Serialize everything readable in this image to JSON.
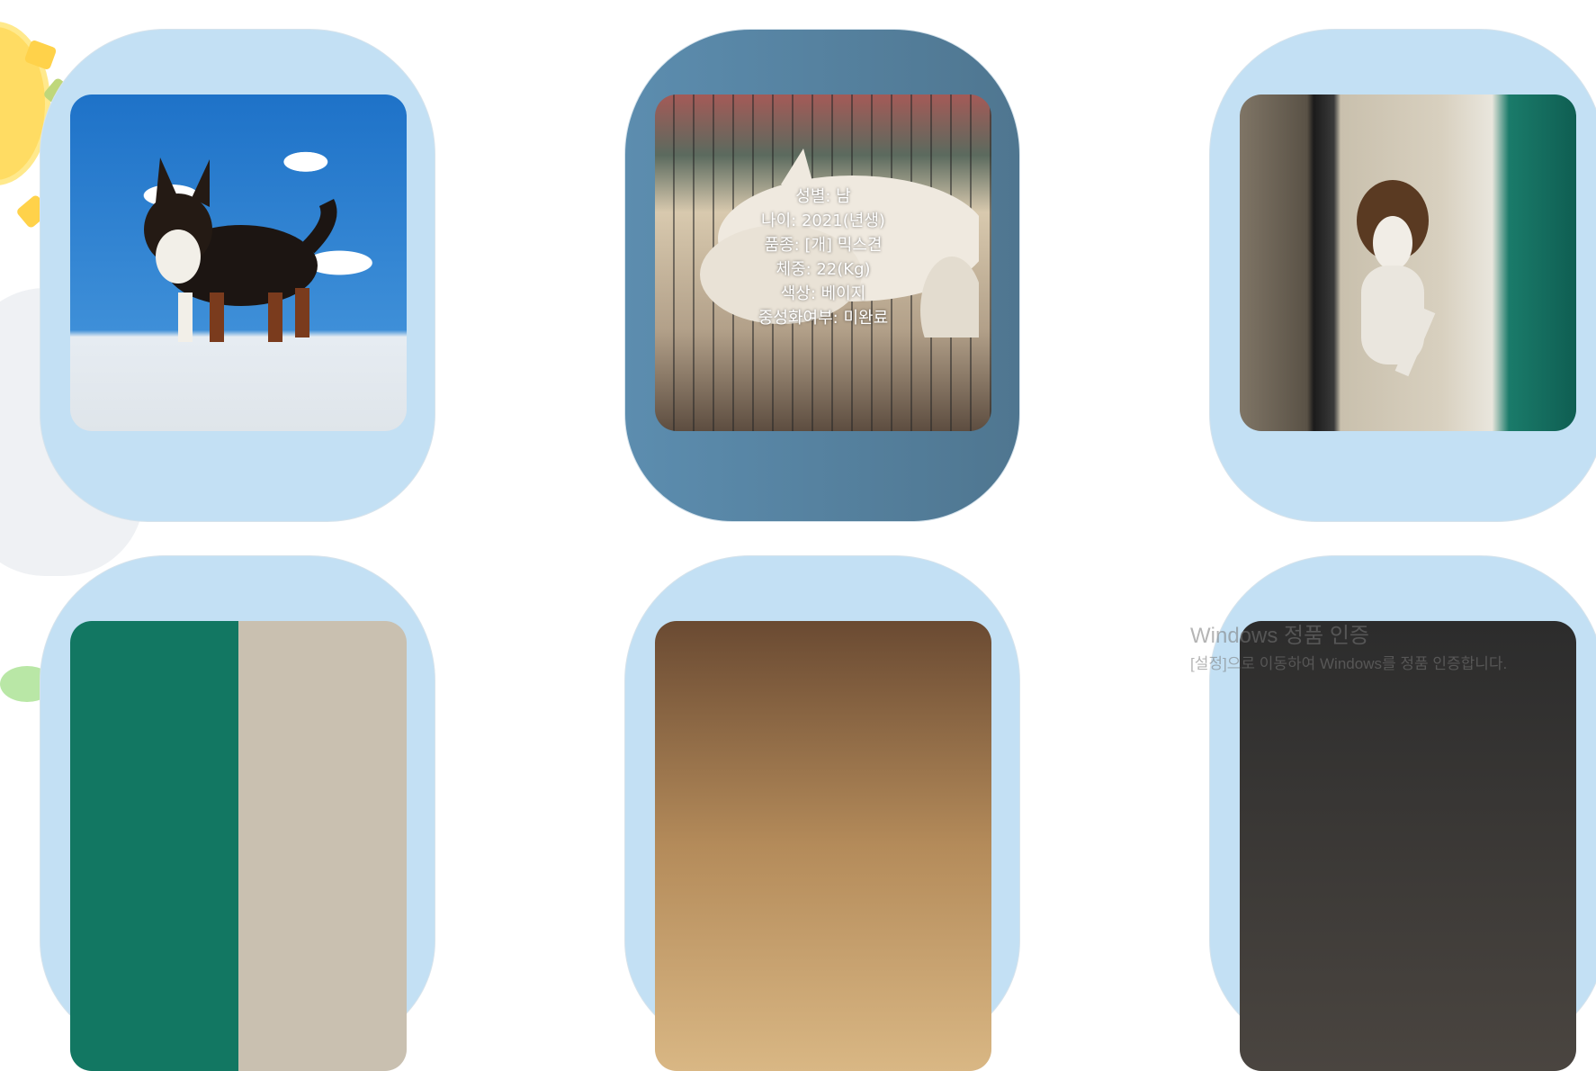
{
  "cards": [
    {
      "name": "dog-card-1",
      "highlighted": false,
      "photo": "black-tan-terrier-mix-photo"
    },
    {
      "name": "dog-card-2",
      "highlighted": true,
      "photo": "white-jindo-mix-photo",
      "info": {
        "gender": "성별: 남",
        "age": "나이: 2021(년생)",
        "breed": "품종: [개] 믹스견",
        "weight": "체중: 22(Kg)",
        "color": "색상: 베이지",
        "neutered": "중성화여부: 미완료"
      }
    },
    {
      "name": "dog-card-3",
      "highlighted": false,
      "photo": "tricolor-chained-dog-photo"
    },
    {
      "name": "dog-card-4",
      "highlighted": false,
      "photo": "kennel-dog-photo"
    },
    {
      "name": "dog-card-5",
      "highlighted": false,
      "photo": "golden-dog-photo"
    },
    {
      "name": "dog-card-6",
      "highlighted": false,
      "photo": "shaggy-dog-photo"
    }
  ],
  "watermark": {
    "title": "Windows 정품 인증",
    "subtitle": "[설정]으로 이동하여 Windows를 정품 인증합니다."
  },
  "colors": {
    "card_bg": "#c3e0f4",
    "card_active_bg": "#5a88a8",
    "info_text": "#ffffff"
  }
}
